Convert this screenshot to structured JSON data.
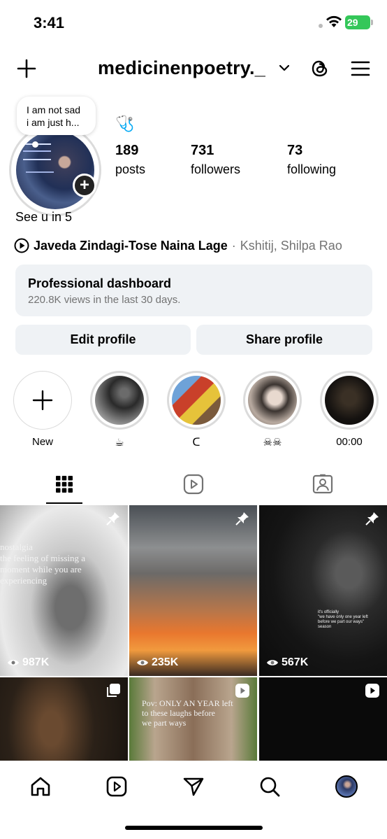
{
  "status_bar": {
    "time": "3:41",
    "battery": "29"
  },
  "header": {
    "username": "medicinenpoetry._",
    "icons": [
      "plus-icon",
      "chevron-down-icon",
      "threads-icon",
      "menu-icon"
    ]
  },
  "profile": {
    "note": "I am not sad\ni am just h...",
    "category_emoji": "🩺",
    "stats": [
      {
        "value": "189",
        "label": "posts"
      },
      {
        "value": "731",
        "label": "followers"
      },
      {
        "value": "73",
        "label": "following"
      }
    ],
    "bio": "See u in 5",
    "music": {
      "title": "Javeda Zindagi-Tose Naina Lage",
      "separator": "·",
      "artist": "Kshitij,  Shilpa Rao"
    }
  },
  "dashboard": {
    "title": "Professional dashboard",
    "subtitle": "220.8K views in the last 30 days."
  },
  "buttons": {
    "edit": "Edit profile",
    "share": "Share profile"
  },
  "highlights": [
    {
      "label": "New"
    },
    {
      "label": "☕"
    },
    {
      "label": "ᑕ"
    },
    {
      "label": "☠☠"
    },
    {
      "label": "00:00"
    }
  ],
  "tabs": [
    "grid-icon",
    "reels-icon",
    "tagged-icon"
  ],
  "grid": {
    "row1": [
      {
        "views": "987K",
        "overlay": "nostalgia\nthe feeling of missing a\nmoment while you are\nexperiencing"
      },
      {
        "views": "235K"
      },
      {
        "views": "567K",
        "overlay": "it's officially\n\"we have only one year left\nbefore we part our ways\"\nseason"
      }
    ],
    "row2": [
      {
        "badge": "carousel-icon"
      },
      {
        "badge": "reel-icon",
        "overlay": "Pov: ONLY AN YEAR left\nto these laughs before\nwe part ways"
      },
      {
        "badge": "reel-icon"
      }
    ]
  },
  "nav": [
    "home-icon",
    "reels-nav-icon",
    "send-icon",
    "search-icon",
    "profile-avatar"
  ],
  "colors": {
    "button_bg": "#eff2f5",
    "muted": "#737373",
    "battery": "#34c759"
  }
}
